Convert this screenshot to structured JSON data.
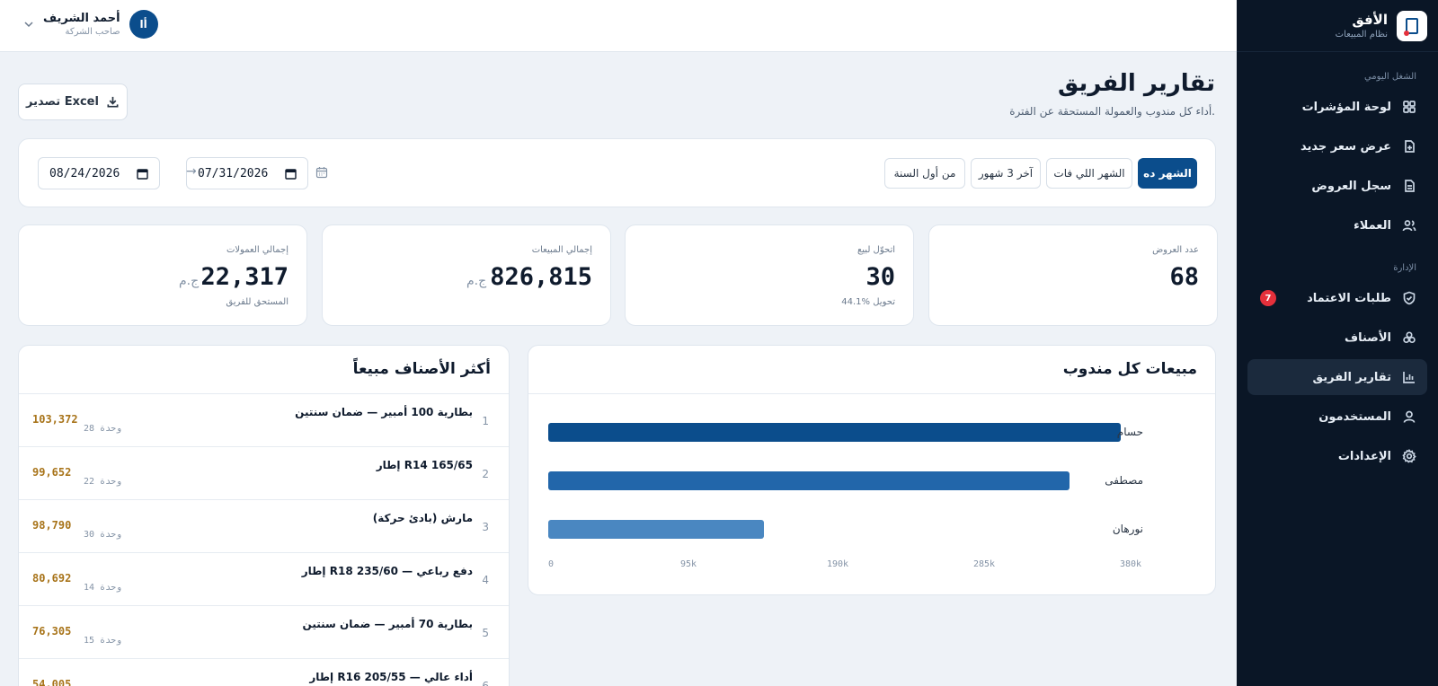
{
  "brand": {
    "title": "الأفق",
    "subtitle": "نظام المبيعات"
  },
  "user": {
    "name": "أحمد الشريف",
    "role": "صاحب الشركة",
    "initials": "أا"
  },
  "sidebar": {
    "sections": [
      {
        "label": "الشغل اليومي"
      },
      {
        "label": "الإدارة"
      }
    ],
    "items": [
      {
        "label": "لوحة المؤشرات",
        "icon": "dashboard-icon"
      },
      {
        "label": "عرض سعر جديد",
        "icon": "new-doc-icon"
      },
      {
        "label": "سجل العروض",
        "icon": "doc-list-icon"
      },
      {
        "label": "العملاء",
        "icon": "users-icon"
      },
      {
        "label": "طلبات الاعتماد",
        "icon": "shield-icon",
        "badge": "7"
      },
      {
        "label": "الأصناف",
        "icon": "boxes-icon"
      },
      {
        "label": "تقارير الفريق",
        "icon": "bar-chart-icon",
        "active": true
      },
      {
        "label": "المستخدمون",
        "icon": "user-icon"
      },
      {
        "label": "الإعدادات",
        "icon": "gear-icon"
      }
    ]
  },
  "page": {
    "title": "تقارير الفريق",
    "subtitle": "أداء كل مندوب والعمولة المستحقة عن الفترة.",
    "export_label": "تصدير Excel"
  },
  "filters": {
    "periods": [
      "الشهر ده",
      "الشهر اللي فات",
      "آخر 3 شهور",
      "من أول السنة"
    ],
    "active_period": "الشهر ده",
    "date_from": "07/31/2026",
    "date_to": "08/24/2026",
    "arrow": "→"
  },
  "kpis": [
    {
      "label": "عدد العروض",
      "value": "68",
      "unit": "",
      "foot": ""
    },
    {
      "label": "اتحوّل لبيع",
      "value": "30",
      "unit": "",
      "foot": "44.1% تحويل"
    },
    {
      "label": "إجمالي المبيعات",
      "value": "826,815",
      "unit": "ج.م",
      "foot": ""
    },
    {
      "label": "إجمالي العمولات",
      "value": "22,317",
      "unit": "ج.م",
      "foot": "المستحق للفريق"
    }
  ],
  "sales_panel": {
    "title": "مبيعات كل مندوب"
  },
  "chart_data": {
    "type": "bar",
    "orientation": "horizontal",
    "title": "مبيعات كل مندوب",
    "categories": [
      "حسام",
      "مصطفى",
      "نورهان"
    ],
    "values": [
      371000,
      338000,
      140000
    ],
    "xlim": [
      0,
      380000
    ],
    "tick_labels": [
      "0",
      "95k",
      "190k",
      "285k",
      "380k"
    ],
    "colors": [
      "#0b4d8c",
      "#2266aa",
      "#4a87c1"
    ],
    "grid": false
  },
  "top_items": {
    "title": "أكثر الأصناف مبيعاً",
    "unit_word": "وحدة",
    "rows": [
      {
        "rank": "1",
        "name": "بطارية 100 أمبير — ضمان سنتين",
        "units": "28",
        "value": "103,372"
      },
      {
        "rank": "2",
        "name": "إطار R14 165/65",
        "units": "22",
        "value": "99,652"
      },
      {
        "rank": "3",
        "name": "مارش (بادئ حركة)",
        "units": "30",
        "value": "98,790"
      },
      {
        "rank": "4",
        "name": "إطار R18 235/60 — دفع رباعي",
        "units": "14",
        "value": "80,692"
      },
      {
        "rank": "5",
        "name": "بطارية 70 أمبير — ضمان سنتين",
        "units": "15",
        "value": "76,305"
      },
      {
        "rank": "6",
        "name": "إطار R16 205/55 — أداء عالي",
        "units": "",
        "value": "54,005"
      }
    ]
  }
}
